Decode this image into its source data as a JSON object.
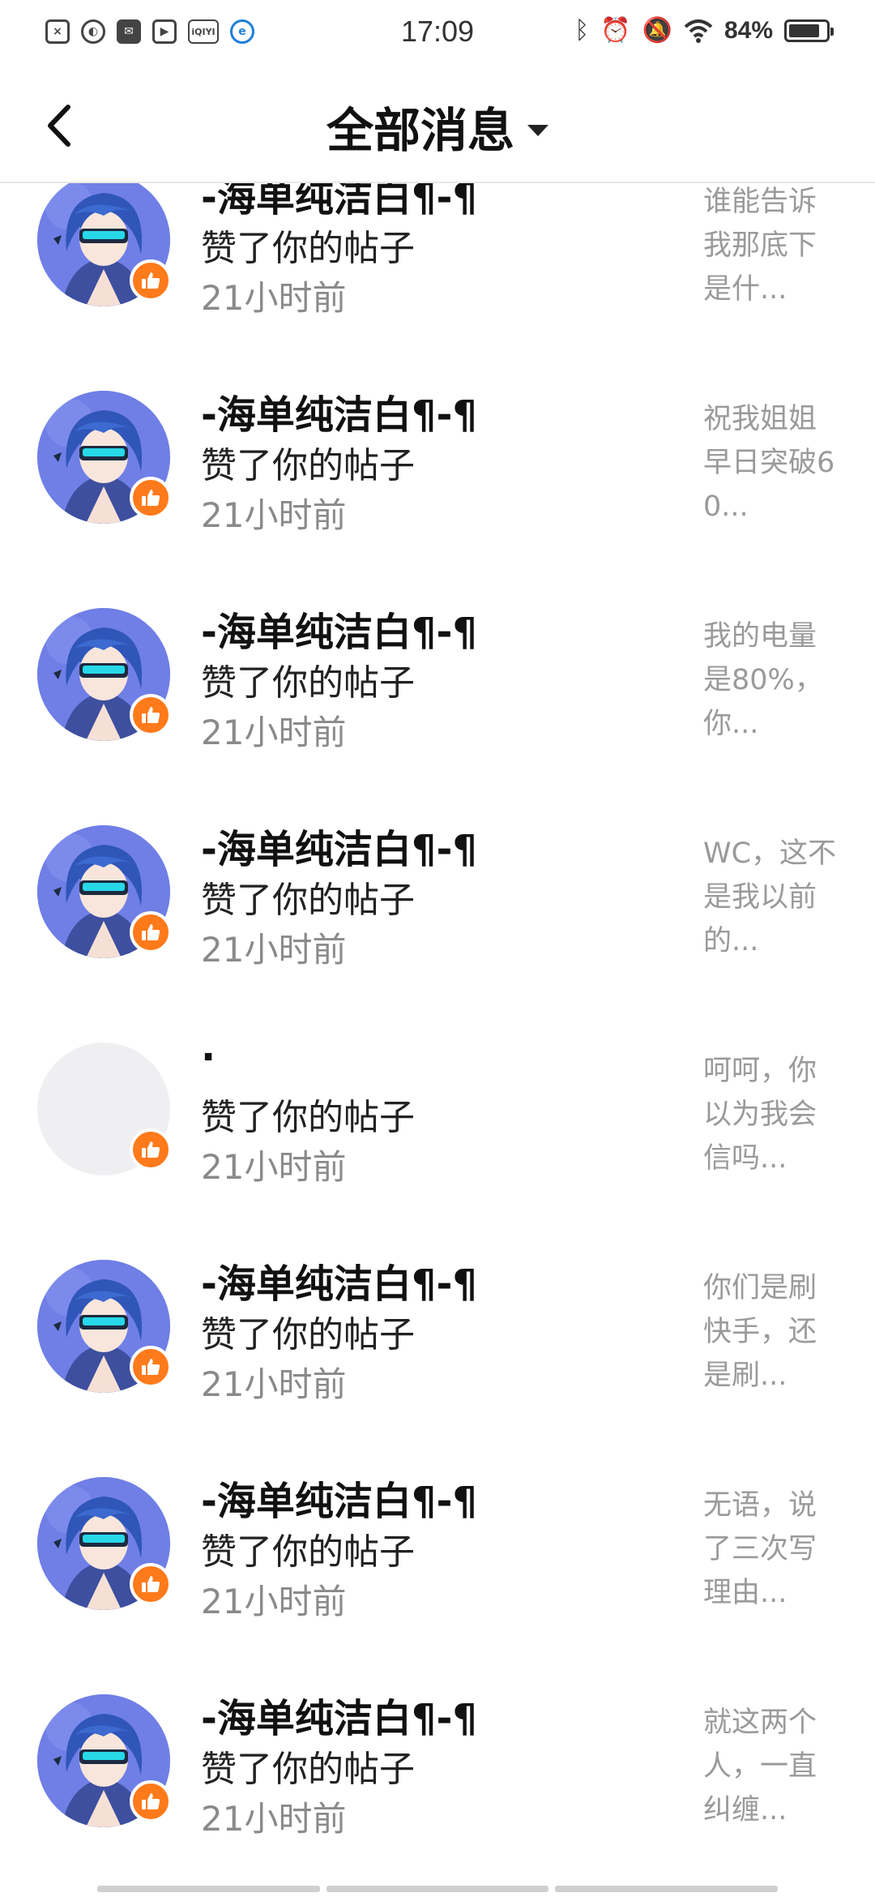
{
  "status_bar": {
    "time": "17:09",
    "battery_percent": "84%",
    "battery_level": 0.84,
    "left_icons": [
      "close-box-icon",
      "leaf-icon",
      "mail-icon",
      "play-icon",
      "iqiyi-icon",
      "browser-icon"
    ],
    "iqiyi_label": "iQIYI",
    "right_icons": [
      "bluetooth-icon",
      "alarm-icon",
      "mute-icon",
      "wifi-icon"
    ]
  },
  "header": {
    "title": "全部消息"
  },
  "colors": {
    "like_badge": "#ff7a1a",
    "avatar_bg": "#6f7fe6",
    "time_text": "#8a8a8a",
    "preview_text": "#9a9a9a"
  },
  "messages": [
    {
      "name": "-海单纯洁白¶-¶",
      "action": "赞了你的帖子",
      "time": "21小时前",
      "preview": "谁能告诉我那底下是什...",
      "avatar": "anime"
    },
    {
      "name": "-海单纯洁白¶-¶",
      "action": "赞了你的帖子",
      "time": "21小时前",
      "preview": "祝我姐姐早日突破60...",
      "avatar": "anime"
    },
    {
      "name": "-海单纯洁白¶-¶",
      "action": "赞了你的帖子",
      "time": "21小时前",
      "preview": "我的电量是80%，你...",
      "avatar": "anime"
    },
    {
      "name": "-海单纯洁白¶-¶",
      "action": "赞了你的帖子",
      "time": "21小时前",
      "preview": "WC，这不是我以前的...",
      "avatar": "anime"
    },
    {
      "name": "·",
      "action": "赞了你的帖子",
      "time": "21小时前",
      "preview": "呵呵，你以为我会信吗...",
      "avatar": "empty"
    },
    {
      "name": "-海单纯洁白¶-¶",
      "action": "赞了你的帖子",
      "time": "21小时前",
      "preview": "你们是刷快手，还是刷...",
      "avatar": "anime"
    },
    {
      "name": "-海单纯洁白¶-¶",
      "action": "赞了你的帖子",
      "time": "21小时前",
      "preview": "无语，说了三次写理由...",
      "avatar": "anime"
    },
    {
      "name": "-海单纯洁白¶-¶",
      "action": "赞了你的帖子",
      "time": "21小时前",
      "preview": "就这两个人，一直纠缠...",
      "avatar": "anime"
    }
  ]
}
